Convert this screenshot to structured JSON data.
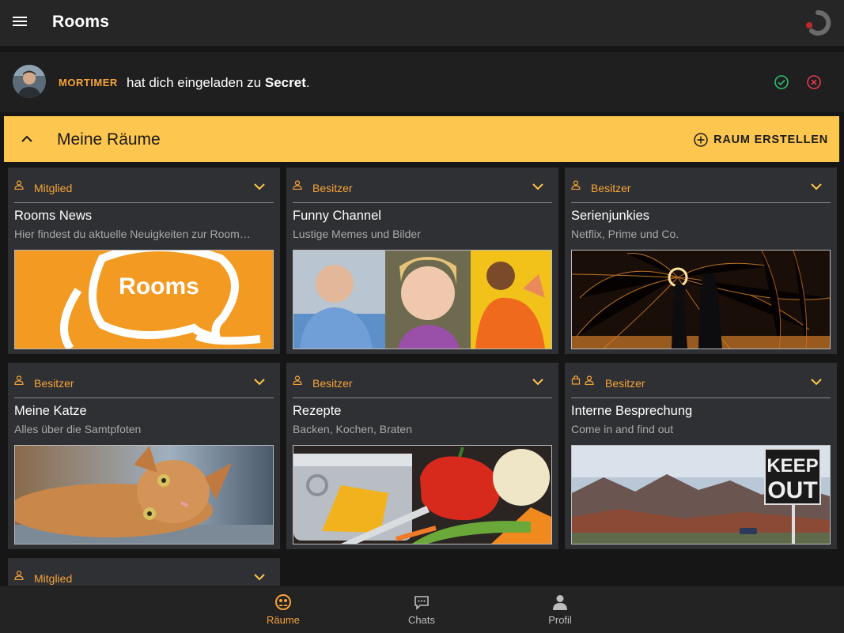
{
  "app": {
    "title": "Rooms"
  },
  "invitation": {
    "user": "MORTIMER",
    "message": "hat dich eingeladen zu",
    "room": "Secret",
    "punct": "."
  },
  "section": {
    "title": "Meine Räume",
    "create_label": "RAUM ERSTELLEN"
  },
  "rooms": [
    {
      "role": "Mitglied",
      "title": "Rooms News",
      "subtitle": "Hier findest du aktuelle Neuigkeiten zur Room…",
      "image": "rooms-logo-image"
    },
    {
      "role": "Besitzer",
      "title": "Funny Channel",
      "subtitle": "Lustige Memes und Bilder",
      "image": "memes-collage-image"
    },
    {
      "role": "Besitzer",
      "title": "Serienjunkies",
      "subtitle": "Netflix, Prime und Co.",
      "image": "steel-wool-sparks-image"
    },
    {
      "role": "Besitzer",
      "title": "Meine Katze",
      "subtitle": "Alles über die Samtpfoten",
      "image": "cat-photo-image"
    },
    {
      "role": "Besitzer",
      "title": "Rezepte",
      "subtitle": "Backen, Kochen, Braten",
      "image": "vegetables-pot-image"
    },
    {
      "role": "Besitzer",
      "title": "Interne Besprechung",
      "subtitle": "Come in and find out",
      "image": "keep-out-sign-image",
      "locked": true
    },
    {
      "role": "Mitglied"
    }
  ],
  "thumb_text": {
    "rooms_logo": "Rooms",
    "keep": "KEEP",
    "out": "OUT"
  },
  "nav": [
    {
      "label": "Räume",
      "icon": "rooms-icon",
      "active": true
    },
    {
      "label": "Chats",
      "icon": "chat-bubble-icon"
    },
    {
      "label": "Profil",
      "icon": "person-icon"
    }
  ],
  "colors": {
    "accent": "#f6a33a",
    "section_bg": "#fdc64f",
    "card_bg": "#2f3033",
    "accept": "#2fbf71",
    "decline": "#e2394f"
  }
}
